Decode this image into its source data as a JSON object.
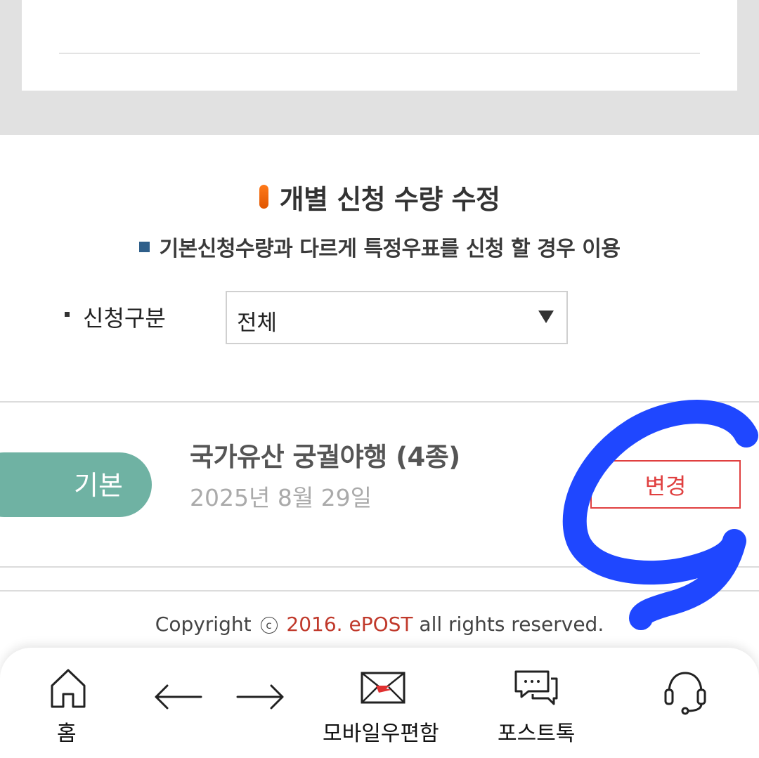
{
  "section": {
    "title": "개별 신청 수량 수정",
    "note": "기본신청수량과 다르게 특정우표를 신청 할 경우 이용"
  },
  "filter": {
    "label": "신청구분",
    "selected": "전체"
  },
  "item": {
    "badge": "기본",
    "title": "국가유산 궁궐야행 (4종)",
    "date": "2025년 8월 29일",
    "change_label": "변경"
  },
  "footer": {
    "copyright_prefix": "Copyright",
    "copyright_symbol": "c",
    "copyright_year": "2016. ePOST",
    "copyright_suffix": "all rights reserved."
  },
  "nav": {
    "home": "홈",
    "mailbox": "모바일우편함",
    "posttalk": "포스트톡"
  },
  "colors": {
    "accent_orange": "#f26b0f",
    "badge_teal": "#6fb2a3",
    "change_red": "#e04040",
    "annotation_blue": "#1f47ff"
  },
  "icons": [
    "home-icon",
    "back-arrow-icon",
    "forward-arrow-icon",
    "mail-icon",
    "chat-icon",
    "headset-icon"
  ]
}
